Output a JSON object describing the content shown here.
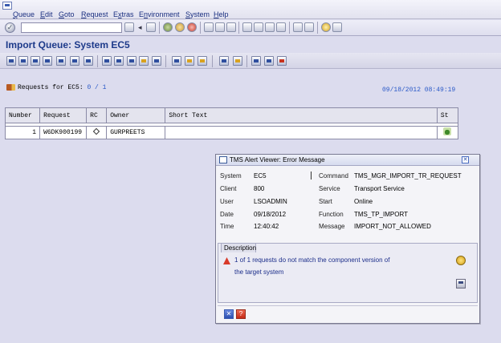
{
  "menubar": {
    "items": [
      {
        "label": "Queue",
        "underline": "Q",
        "rest": "ueue"
      },
      {
        "label": "Edit",
        "underline": "E",
        "rest": "dit"
      },
      {
        "label": "Goto",
        "underline": "G",
        "rest": "oto"
      },
      {
        "label": "Request",
        "underline": "R",
        "rest": "equest"
      },
      {
        "label": "Extras",
        "underline": "x",
        "pre": "E",
        "rest": "tras"
      },
      {
        "label": "Environment",
        "underline": "n",
        "pre": "E",
        "rest": "vironment"
      },
      {
        "label": "System",
        "underline": "S",
        "rest": "ystem"
      },
      {
        "label": "Help",
        "underline": "H",
        "rest": "elp"
      }
    ]
  },
  "toolbar": {
    "command_field_value": ""
  },
  "page": {
    "title": "Import Queue: System EC5"
  },
  "requests": {
    "label": "Requests for EC5:",
    "value": "0 / 1",
    "timestamp": "09/18/2012 08:49:19"
  },
  "table": {
    "columns": [
      "Number",
      "Request",
      "RC",
      "Owner",
      "Short Text",
      "St"
    ],
    "rows": [
      {
        "number": "1",
        "request": "W6DK900199",
        "rc_icon": "diamond-icon",
        "owner": "GURPREETS",
        "short_text": "",
        "status_icon": "import-status-icon"
      }
    ]
  },
  "dialog": {
    "title": "TMS Alert Viewer: Error Message",
    "fields_left": [
      {
        "label": "System",
        "value": "EC5"
      },
      {
        "label": "Client",
        "value": "800"
      },
      {
        "label": "User",
        "value": "LSOADMIN"
      },
      {
        "label": "Date",
        "value": "09/18/2012"
      },
      {
        "label": "Time",
        "value": "12:40:42"
      }
    ],
    "fields_right": [
      {
        "label": "Command",
        "value": "TMS_MGR_IMPORT_TR_REQUEST"
      },
      {
        "label": "Service",
        "value": "Transport Service"
      },
      {
        "label": "Start",
        "value": "Online"
      },
      {
        "label": "Function",
        "value": "TMS_TP_IMPORT"
      },
      {
        "label": "Message",
        "value": "IMPORT_NOT_ALLOWED"
      }
    ],
    "description_tab": "Description",
    "error_line_1": "1 of 1 requests do not match the component version of",
    "error_line_2": "the target system"
  },
  "colors": {
    "background": "#dcdcee",
    "title_blue": "#1d3a8a",
    "link_blue": "#2b5ac8",
    "error_red": "#d83a2a"
  }
}
